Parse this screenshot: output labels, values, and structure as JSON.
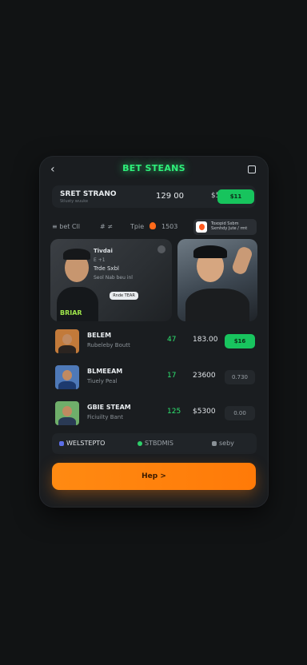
{
  "header": {
    "title": "BET STEANS",
    "back_glyph": "‹"
  },
  "balance": {
    "name": "SRET STRANO",
    "sub": "Stlusty wuuke",
    "amount": "129 00",
    "small": "$5",
    "button": "$11"
  },
  "filters": {
    "f1": "≡ bet Cll",
    "f2": "# ≠",
    "f3": "Tpie",
    "f4": "1503"
  },
  "promo": {
    "line1": "Toxopid Sxbm",
    "line2": "Sxmhdy Jute / rmt"
  },
  "hero": {
    "title": "Tivdai",
    "line2": "E +1",
    "line3": "Trde Sxbl",
    "line4": "Seol Nab beu inl",
    "chip": "Rnde TEAR",
    "jersey": "BRIAR"
  },
  "rows": [
    {
      "name": "BELEM",
      "sub": "Rubeleby Boutt",
      "num": "47",
      "value": "183.00",
      "button": "$16",
      "active": true
    },
    {
      "name": "BLMEEAM",
      "sub": "Tiuely Peal",
      "num": "17",
      "value": "23600",
      "button": "0.730",
      "active": false
    },
    {
      "name": "GBIE STEAM",
      "sub": "Ficiuilty Bant",
      "num": "125",
      "value": "$5300",
      "button": "0.00",
      "active": false
    }
  ],
  "tabs": {
    "t1": "WELSTEPTO",
    "t2": "STBDMIS",
    "t3": "seby"
  },
  "cta": {
    "label": "Hep >"
  },
  "colors": {
    "accent_green": "#18c45e",
    "accent_orange": "#ff7a08"
  }
}
